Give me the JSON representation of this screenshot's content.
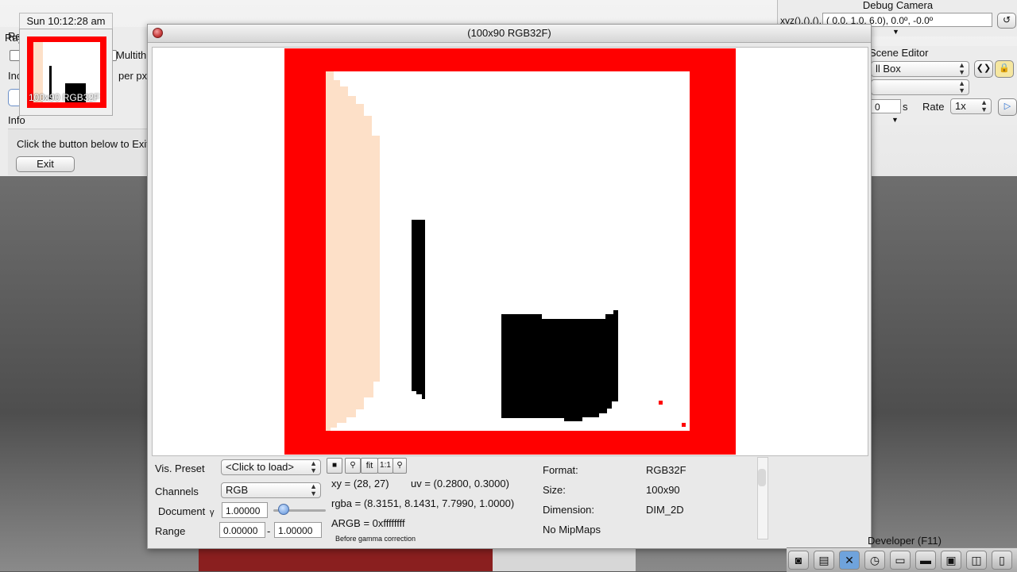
{
  "window": {
    "title": "(100x90 RGB32F)"
  },
  "clock": {
    "time": "Sun 10:12:28 am"
  },
  "thumbnail": {
    "label": "100x90 RGB32F"
  },
  "left_panel": {
    "title_partial": "Ray T",
    "row1_partial": "Re",
    "multithread_label": "Multith",
    "inc_partial": "Inc",
    "per_px_label": "per px",
    "info_label": "Info",
    "info_text": "Click the button below to Exit",
    "exit_button": "Exit"
  },
  "debug_camera": {
    "title": "Debug Camera",
    "xyz_label": "xyz(),(),(),",
    "xyz_value": "( 0.0,  1.0,  6.0),  0.0º,  -0.0º"
  },
  "scene_editor": {
    "title": "Scene Editor",
    "object_select": "ll Box",
    "time_value": "0",
    "time_unit": "s",
    "rate_label": "Rate",
    "rate_value": "1x"
  },
  "controls": {
    "vis_preset_label": "Vis. Preset",
    "vis_preset_value": "<Click to load>",
    "channels_label": "Channels",
    "channels_value": "RGB",
    "document_label": "Document",
    "gamma_symbol": "γ",
    "gamma_value": "1.00000",
    "gamma_slider": 0.12,
    "range_label": "Range",
    "range_min": "0.00000",
    "range_dash": "-",
    "range_max": "1.00000",
    "tool_fit": "fit",
    "tool_one": "1:1"
  },
  "pixel_info": {
    "xy": "xy =  (28, 27)",
    "uv": "uv =  (0.2800, 0.3000)",
    "rgba": "rgba =  (8.3151, 8.1431, 7.7990, 1.0000)",
    "argb": "ARGB =  0xffffffff",
    "note": "Before gamma correction"
  },
  "format_info": {
    "format_label": "Format:",
    "format_value": "RGB32F",
    "size_label": "Size:",
    "size_value": "100x90",
    "dimension_label": "Dimension:",
    "dimension_value": "DIM_2D",
    "mipmaps": "No MipMaps"
  },
  "dock": {
    "developer_label": "Developer (F11)"
  },
  "colors": {
    "red": "#ff0000",
    "peach": "#fde0c8",
    "black": "#000000",
    "white": "#ffffff"
  }
}
